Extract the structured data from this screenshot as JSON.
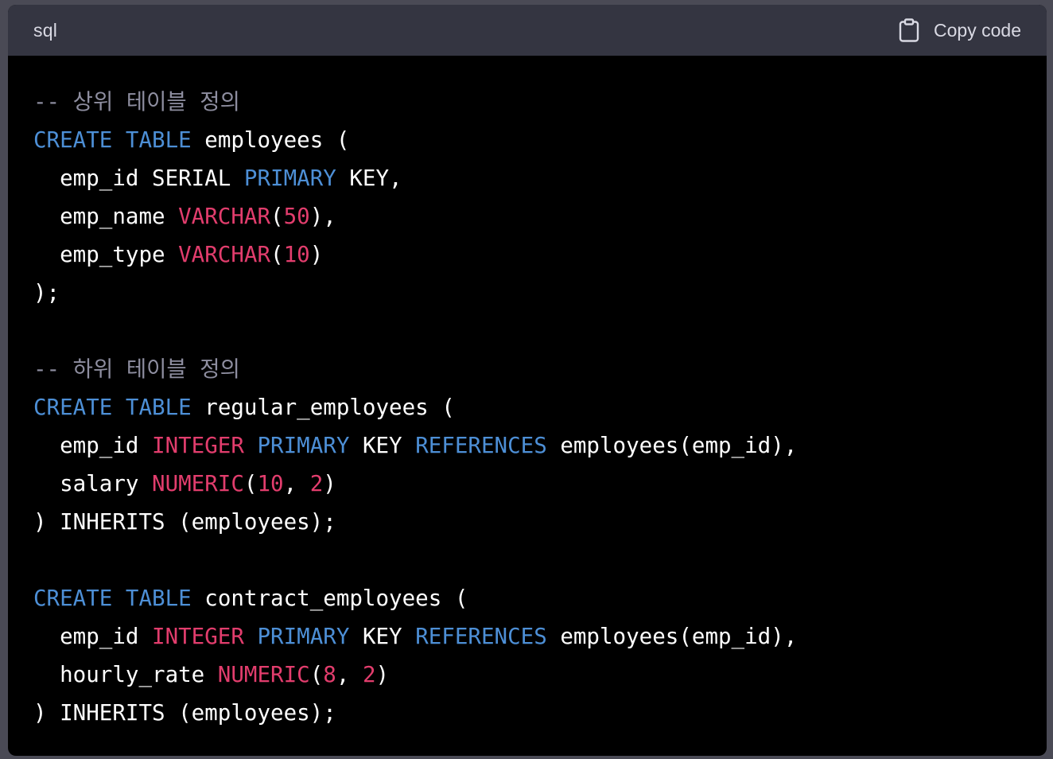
{
  "header": {
    "language": "sql",
    "copy_label": "Copy code",
    "copy_icon": "clipboard-icon"
  },
  "colors": {
    "keyword": "#4d8fd6",
    "type": "#e23d6d",
    "number": "#e23d6d",
    "comment": "#8e8ea0",
    "text": "#ffffff",
    "header_bg": "#343541",
    "code_bg": "#000000"
  },
  "code": {
    "lines": [
      [
        {
          "t": "cm",
          "v": "-- 상위 테이블 정의"
        }
      ],
      [
        {
          "t": "kw",
          "v": "CREATE"
        },
        {
          "t": "tx",
          "v": " "
        },
        {
          "t": "kw",
          "v": "TABLE"
        },
        {
          "t": "tx",
          "v": " employees ("
        }
      ],
      [
        {
          "t": "tx",
          "v": "  emp_id SERIAL "
        },
        {
          "t": "kw",
          "v": "PRIMARY"
        },
        {
          "t": "tx",
          "v": " KEY,"
        }
      ],
      [
        {
          "t": "tx",
          "v": "  emp_name "
        },
        {
          "t": "ty",
          "v": "VARCHAR"
        },
        {
          "t": "tx",
          "v": "("
        },
        {
          "t": "num",
          "v": "50"
        },
        {
          "t": "tx",
          "v": "),"
        }
      ],
      [
        {
          "t": "tx",
          "v": "  emp_type "
        },
        {
          "t": "ty",
          "v": "VARCHAR"
        },
        {
          "t": "tx",
          "v": "("
        },
        {
          "t": "num",
          "v": "10"
        },
        {
          "t": "tx",
          "v": ")"
        }
      ],
      [
        {
          "t": "tx",
          "v": ");"
        }
      ],
      [],
      [
        {
          "t": "cm",
          "v": "-- 하위 테이블 정의"
        }
      ],
      [
        {
          "t": "kw",
          "v": "CREATE"
        },
        {
          "t": "tx",
          "v": " "
        },
        {
          "t": "kw",
          "v": "TABLE"
        },
        {
          "t": "tx",
          "v": " regular_employees ("
        }
      ],
      [
        {
          "t": "tx",
          "v": "  emp_id "
        },
        {
          "t": "ty",
          "v": "INTEGER"
        },
        {
          "t": "tx",
          "v": " "
        },
        {
          "t": "kw",
          "v": "PRIMARY"
        },
        {
          "t": "tx",
          "v": " KEY "
        },
        {
          "t": "kw",
          "v": "REFERENCES"
        },
        {
          "t": "tx",
          "v": " employees(emp_id),"
        }
      ],
      [
        {
          "t": "tx",
          "v": "  salary "
        },
        {
          "t": "ty",
          "v": "NUMERIC"
        },
        {
          "t": "tx",
          "v": "("
        },
        {
          "t": "num",
          "v": "10"
        },
        {
          "t": "tx",
          "v": ", "
        },
        {
          "t": "num",
          "v": "2"
        },
        {
          "t": "tx",
          "v": ")"
        }
      ],
      [
        {
          "t": "tx",
          "v": ") INHERITS (employees);"
        }
      ],
      [],
      [
        {
          "t": "kw",
          "v": "CREATE"
        },
        {
          "t": "tx",
          "v": " "
        },
        {
          "t": "kw",
          "v": "TABLE"
        },
        {
          "t": "tx",
          "v": " contract_employees ("
        }
      ],
      [
        {
          "t": "tx",
          "v": "  emp_id "
        },
        {
          "t": "ty",
          "v": "INTEGER"
        },
        {
          "t": "tx",
          "v": " "
        },
        {
          "t": "kw",
          "v": "PRIMARY"
        },
        {
          "t": "tx",
          "v": " KEY "
        },
        {
          "t": "kw",
          "v": "REFERENCES"
        },
        {
          "t": "tx",
          "v": " employees(emp_id),"
        }
      ],
      [
        {
          "t": "tx",
          "v": "  hourly_rate "
        },
        {
          "t": "ty",
          "v": "NUMERIC"
        },
        {
          "t": "tx",
          "v": "("
        },
        {
          "t": "num",
          "v": "8"
        },
        {
          "t": "tx",
          "v": ", "
        },
        {
          "t": "num",
          "v": "2"
        },
        {
          "t": "tx",
          "v": ")"
        }
      ],
      [
        {
          "t": "tx",
          "v": ") INHERITS (employees);"
        }
      ]
    ]
  }
}
